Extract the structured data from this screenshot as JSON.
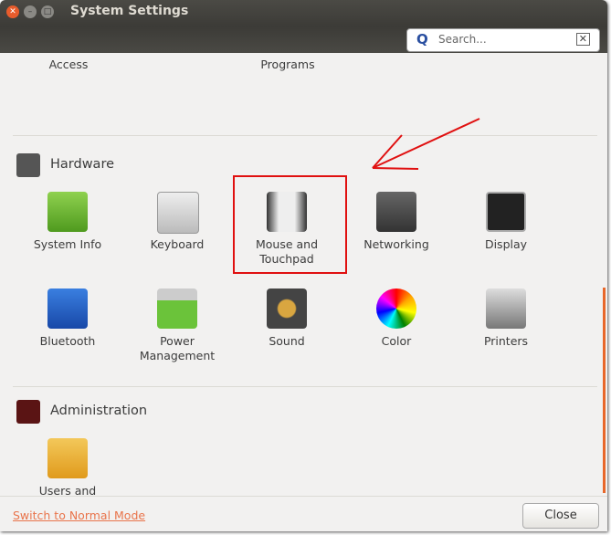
{
  "window": {
    "title": "System Settings"
  },
  "search": {
    "placeholder": "Search..."
  },
  "partial_row": [
    {
      "label": "Access"
    },
    {
      "label": "Programs"
    }
  ],
  "sections": [
    {
      "title": "Hardware",
      "items": [
        {
          "label": "System Info"
        },
        {
          "label": "Keyboard"
        },
        {
          "label": "Mouse and Touchpad"
        },
        {
          "label": "Networking"
        },
        {
          "label": "Display"
        },
        {
          "label": "Bluetooth"
        },
        {
          "label": "Power Management"
        },
        {
          "label": "Sound"
        },
        {
          "label": "Color"
        },
        {
          "label": "Printers"
        }
      ]
    },
    {
      "title": "Administration",
      "items": [
        {
          "label": "Users and"
        }
      ]
    }
  ],
  "footer": {
    "switch_label": "Switch to Normal Mode",
    "close_label": "Close"
  },
  "colors": {
    "accent": "#e9744b",
    "annotation": "#e01010"
  }
}
